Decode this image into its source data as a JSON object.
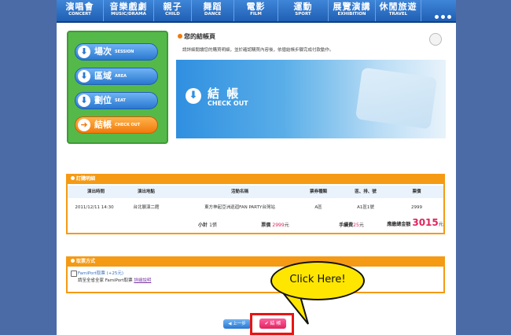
{
  "nav": {
    "items": [
      {
        "zh": "演唱會",
        "en": "CONCERT"
      },
      {
        "zh": "音樂戲劇",
        "en": "MUSIC/DRAMA"
      },
      {
        "zh": "親子",
        "en": "CHILD"
      },
      {
        "zh": "舞蹈",
        "en": "DANCE"
      },
      {
        "zh": "電影",
        "en": "FILM"
      },
      {
        "zh": "運動",
        "en": "SPORT"
      },
      {
        "zh": "展覽演講",
        "en": "EXHIBITION"
      },
      {
        "zh": "休閒旅遊",
        "en": "TRAVEL"
      }
    ]
  },
  "steps": [
    {
      "zh": "場次",
      "en": "SESSION"
    },
    {
      "zh": "區域",
      "en": "AREA"
    },
    {
      "zh": "劃位",
      "en": "SEAT"
    },
    {
      "zh": "結帳",
      "en": "CHECK OUT"
    }
  ],
  "checkout": {
    "title": "您的結帳頁",
    "desc": "請詳細閱讀您的購買明細，並於確認購買內容後，依循結帳步驟完成付款動作。",
    "banner_zh": "結 帳",
    "banner_en": "CHECK OUT"
  },
  "order": {
    "section_title": "訂購明細",
    "headers": [
      "演出時間",
      "演出地點",
      "活動名稱",
      "票券種類",
      "區、排、號",
      "票價"
    ],
    "row": [
      "2011/12/11 14:30",
      "台北展演二館",
      "東方神起亞洲巡迴FAN PARTY台灣站",
      "A區",
      "A1區1號",
      "2999"
    ],
    "subtotal_label": "小計",
    "subtotal_value": "1張",
    "price_label": "票價",
    "price_value": "2999",
    "price_unit": "元",
    "fee_label": "手續費",
    "fee_value": "25",
    "fee_unit": "元",
    "total_label": "應繳總金額",
    "total_value": "3015",
    "total_unit": "元"
  },
  "pickup": {
    "section_title": "取票方式",
    "option": "FamiPort取票 (+25元)",
    "desc": "請至全省全家 FamiPort取票",
    "link": "詳細說明"
  },
  "callout": "Click Here!",
  "buttons": {
    "prev": "上一步",
    "next": "結 帳"
  }
}
